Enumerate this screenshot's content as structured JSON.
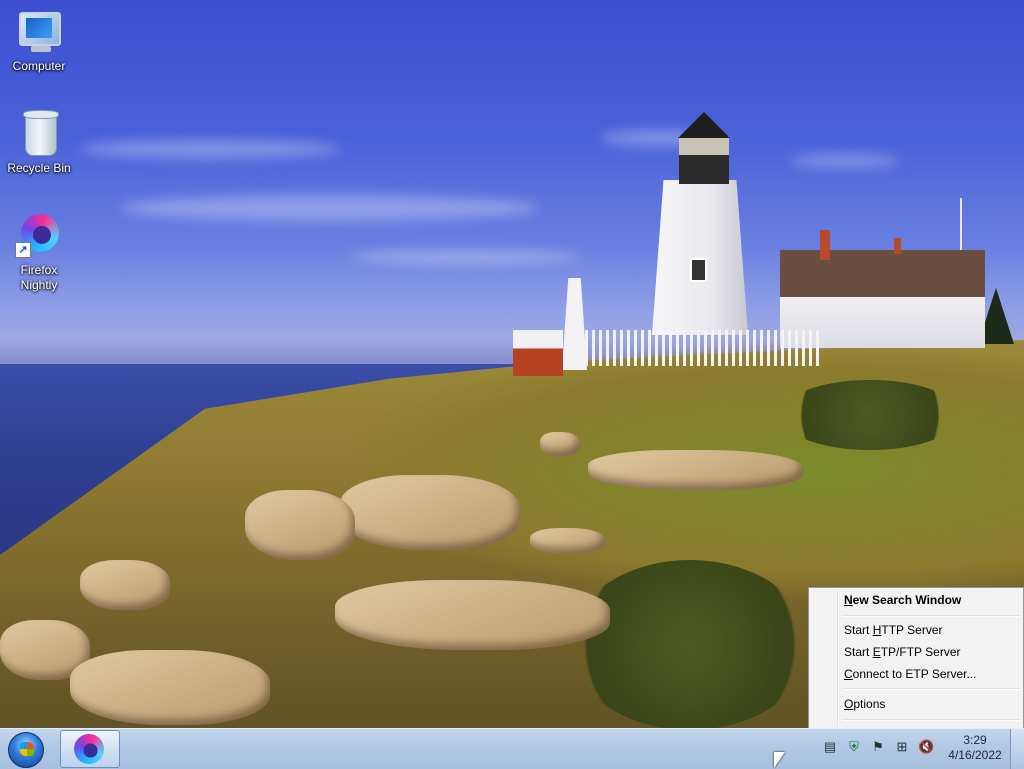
{
  "desktop": {
    "icons": [
      {
        "label": "Computer",
        "icon": "computer-icon"
      },
      {
        "label": "Recycle Bin",
        "icon": "recycle-bin-icon"
      },
      {
        "label": "Firefox Nightly",
        "label_line1": "Firefox",
        "label_line2": "Nightly",
        "icon": "firefox-nightly-icon"
      }
    ]
  },
  "context_menu": {
    "items": [
      {
        "label": "New Search Window",
        "mnemonic": "N",
        "rest": "ew Search Window",
        "bold": true
      },
      {
        "label": "Start HTTP Server",
        "pre": "Start ",
        "mnemonic": "H",
        "rest": "TTP Server"
      },
      {
        "label": "Start ETP/FTP Server",
        "pre": "Start ",
        "mnemonic": "E",
        "rest": "TP/FTP Server"
      },
      {
        "label": "Connect to ETP Server...",
        "mnemonic": "C",
        "rest": "onnect to ETP Server..."
      },
      {
        "label": "Options",
        "mnemonic": "O",
        "rest": "ptions"
      }
    ]
  },
  "taskbar": {
    "start_icon": "windows-start-orb-icon",
    "pinned": [
      {
        "icon": "firefox-nightly-icon"
      }
    ],
    "tray_icons": [
      "everything-search-icon",
      "security-shield-icon",
      "action-center-flag-icon",
      "network-icon",
      "volume-muted-icon"
    ],
    "clock": {
      "time": "3:29",
      "date": "4/16/2022"
    }
  },
  "colors": {
    "taskbar": "#b3c9e4",
    "menu_bg": "#f2f2f2",
    "menu_border": "#979797"
  }
}
